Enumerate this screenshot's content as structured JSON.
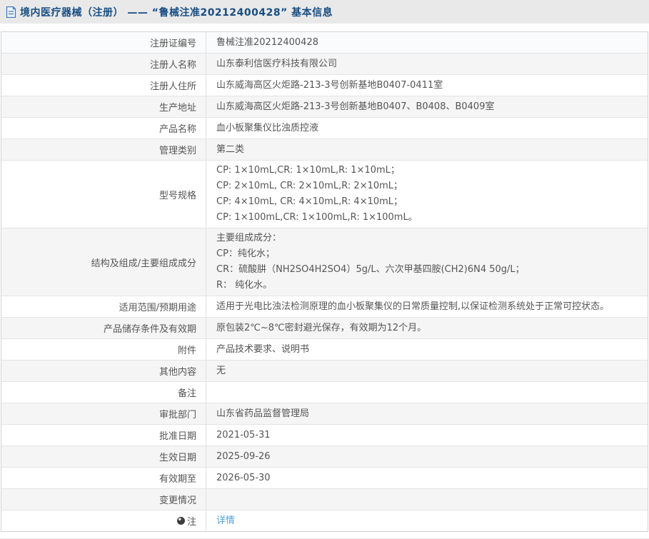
{
  "header": {
    "icon": "document-icon",
    "title": "境内医疗器械（注册） —— “鲁械注准20212400428” 基本信息"
  },
  "colors": {
    "title_blue": "#174e82",
    "link_blue": "#4d9fdf",
    "stripe_gray": "#f5f5f5",
    "header_bg": "#e9e9e9"
  },
  "table": {
    "rows": [
      {
        "label": "注册证编号",
        "value": "鲁械注准20212400428"
      },
      {
        "label": "注册人名称",
        "value": "山东泰利信医疗科技有限公司"
      },
      {
        "label": "注册人住所",
        "value": "山东威海高区火炬路-213-3号创新基地B0407-0411室"
      },
      {
        "label": "生产地址",
        "value": "山东威海高区火炬路-213-3号创新基地B0407、B0408、B0409室"
      },
      {
        "label": "产品名称",
        "value": "血小板聚集仪比浊质控液"
      },
      {
        "label": "管理类别",
        "value": "第二类"
      },
      {
        "label": "型号规格",
        "lines": [
          "CP: 1×10mL,CR: 1×10mL,R: 1×10mL；",
          "CP: 2×10mL, CR: 2×10mL,R: 2×10mL；",
          "CP: 4×10mL, CR: 4×10mL,R: 4×10mL；",
          "CP: 1×100mL,CR: 1×100mL,R: 1×100mL。"
        ]
      },
      {
        "label": "结构及组成/主要组成成分",
        "lines": [
          "主要组成成分：",
          "CP：纯化水；",
          "CR：硫酸肼（NH2SO4H2SO4）5g/L、六次甲基四胺(CH2)6N4 50g/L；",
          "R： 纯化水。"
        ]
      },
      {
        "label": "适用范围/预期用途",
        "value": "适用于光电比浊法检测原理的血小板聚集仪的日常质量控制,以保证检测系统处于正常可控状态。"
      },
      {
        "label": "产品储存条件及有效期",
        "value": "原包装2℃~8℃密封避光保存，有效期为12个月。"
      },
      {
        "label": "附件",
        "value": "产品技术要求、说明书"
      },
      {
        "label": "其他内容",
        "value": "无"
      },
      {
        "label": "备注",
        "value": ""
      },
      {
        "label": "审批部门",
        "value": "山东省药品监督管理局"
      },
      {
        "label": "批准日期",
        "value": "2021-05-31"
      },
      {
        "label": "生效日期",
        "value": "2025-09-26"
      },
      {
        "label": "有效期至",
        "value": "2026-05-30"
      },
      {
        "label": "变更情况",
        "value": ""
      },
      {
        "label": "注",
        "icon": "note-icon",
        "link": "详情"
      }
    ]
  }
}
